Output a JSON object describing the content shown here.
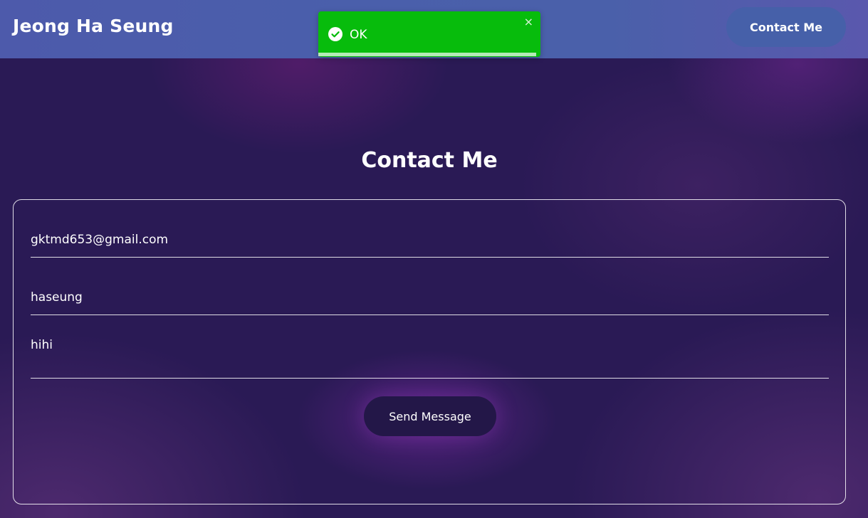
{
  "header": {
    "brand": "Jeong Ha Seung",
    "nav_contact_label": "Contact Me"
  },
  "toast": {
    "message": "OK",
    "close_glyph": "×",
    "icon": "check-circle-icon",
    "progress_fraction": 0.98,
    "color": "#07bc0c"
  },
  "contact": {
    "title": "Contact Me",
    "email_value": "gktmd653@gmail.com",
    "name_value": "haseung",
    "message_value": "hihi",
    "send_label": "Send Message"
  },
  "colors": {
    "header_bg": "#4a5fab",
    "page_bg": "#2a1a55",
    "button_bg": "#231748"
  }
}
